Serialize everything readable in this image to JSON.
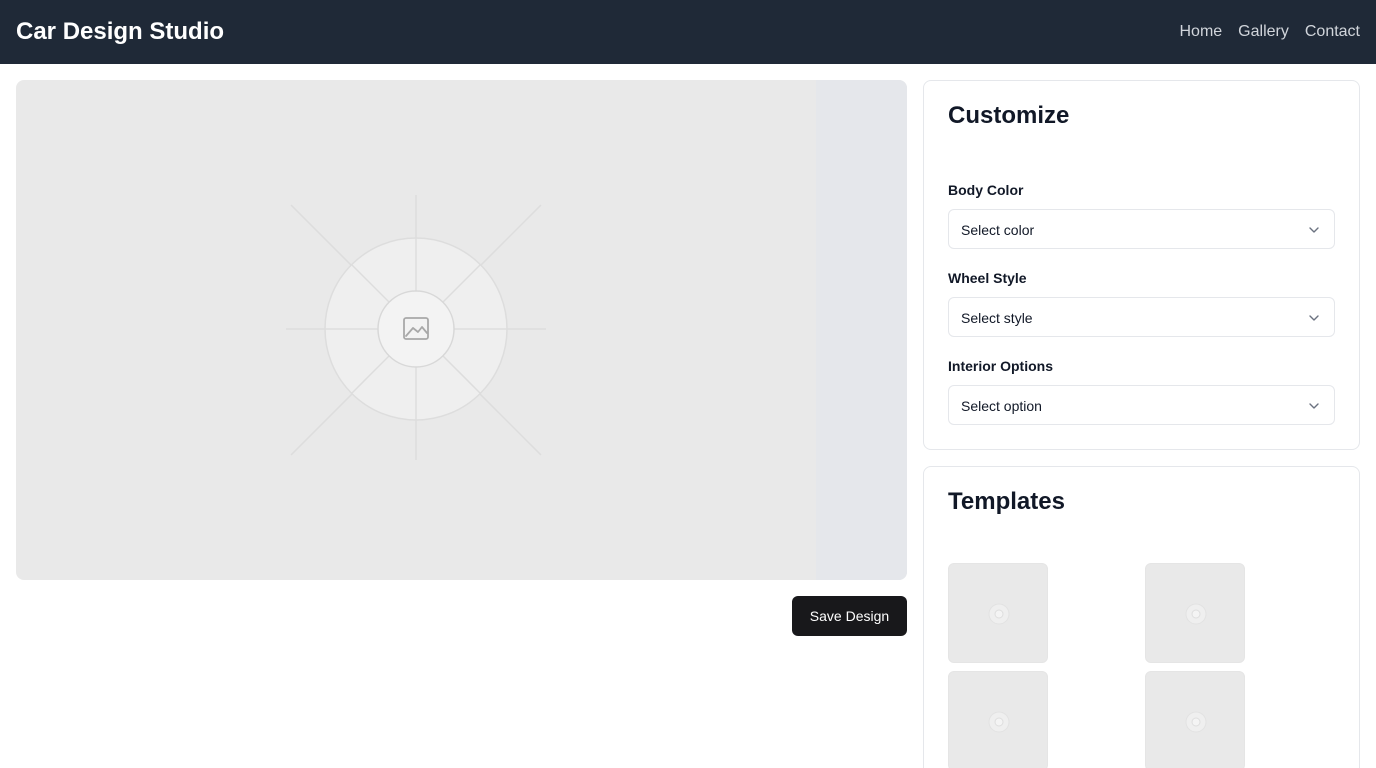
{
  "header": {
    "brand": "Car Design Studio",
    "nav": [
      "Home",
      "Gallery",
      "Contact"
    ]
  },
  "preview": {
    "icon": "image-placeholder-icon"
  },
  "actions": {
    "save_label": "Save Design"
  },
  "customize": {
    "title": "Customize",
    "fields": [
      {
        "label": "Body Color",
        "value": "Select color"
      },
      {
        "label": "Wheel Style",
        "value": "Select style"
      },
      {
        "label": "Interior Options",
        "value": "Select option"
      }
    ]
  },
  "templates": {
    "title": "Templates",
    "count_visible": 4
  },
  "colors": {
    "header_bg": "#1f2937",
    "button_bg": "#18181b",
    "placeholder_bg": "#e9e9e9"
  }
}
